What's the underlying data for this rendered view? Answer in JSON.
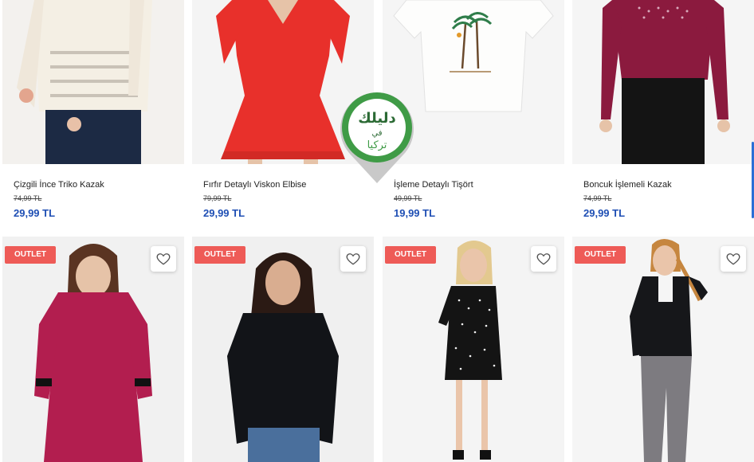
{
  "products_row1": [
    {
      "name": "Çizgili İnce Triko Kazak",
      "old_price": "74,99 TL",
      "price": "29,99 TL"
    },
    {
      "name": "Fırfır Detaylı Viskon Elbise",
      "old_price": "79,99 TL",
      "price": "29,99 TL"
    },
    {
      "name": "İşleme Detaylı Tişört",
      "old_price": "49,99 TL",
      "price": "19,99 TL"
    },
    {
      "name": "Boncuk İşlemeli Kazak",
      "old_price": "74,99 TL",
      "price": "29,99 TL"
    }
  ],
  "products_row2": [
    {
      "badge": "OUTLET",
      "icon": "heart-icon"
    },
    {
      "badge": "OUTLET",
      "icon": "heart-icon"
    },
    {
      "badge": "OUTLET",
      "icon": "heart-icon"
    },
    {
      "badge": "OUTLET",
      "icon": "heart-icon"
    }
  ],
  "watermark": {
    "line1": "دليلك",
    "line2": "في",
    "line3": "تركيا"
  },
  "colors": {
    "price": "#1f4fb4",
    "badge": "#ee5b57",
    "accent": "#2b6fd6"
  }
}
